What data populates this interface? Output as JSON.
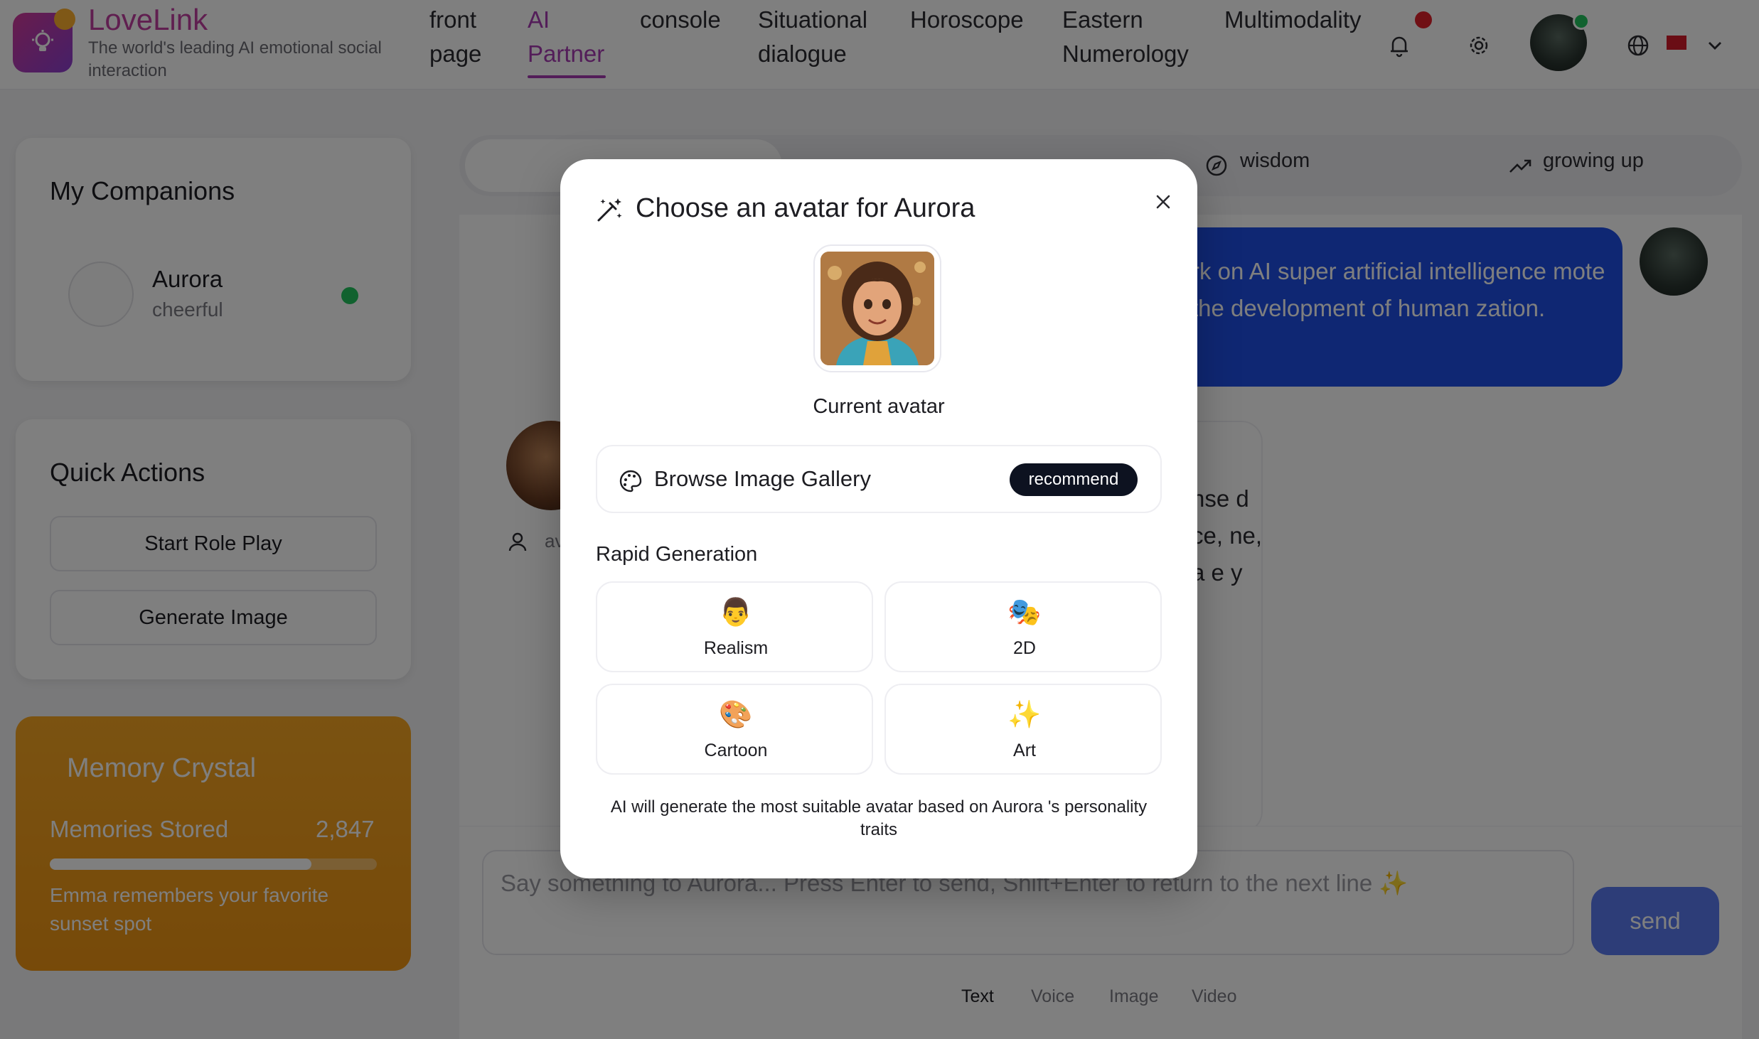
{
  "header": {
    "brand": "LoveLink",
    "tagline": "The world's leading AI emotional social interaction",
    "nav": [
      {
        "label": "front page"
      },
      {
        "label": "AI Partner"
      },
      {
        "label": "console"
      },
      {
        "label": "Situational dialogue"
      },
      {
        "label": "Horoscope"
      },
      {
        "label": "Eastern Numerology"
      },
      {
        "label": "Multimodality"
      }
    ],
    "icons": [
      "bell-icon",
      "gear-icon",
      "globe-icon",
      "chevron-down-icon"
    ]
  },
  "sidebar": {
    "companions_title": "My Companions",
    "companion": {
      "name": "Aurora",
      "mood": "cheerful"
    },
    "quick_title": "Quick Actions",
    "actions": [
      "Start Role Play",
      "Generate Image"
    ],
    "memory": {
      "title": "Memory Crystal",
      "label": "Memories Stored",
      "count": "2,847",
      "progress": 0.8,
      "note": "Emma remembers your favorite sunset spot"
    }
  },
  "main": {
    "tabs": [
      {
        "label": "wisdom"
      },
      {
        "label": "growing up"
      }
    ],
    "user_message": "rk on AI super artificial intelligence mote the development of human zation.",
    "ai_message_fragment": "nse d ce, ne, a e y",
    "ai_meta_fragment": "av",
    "input_placeholder": "Say something to Aurora... Press Enter to send, Shift+Enter to return to the next line ✨",
    "send_label": "send",
    "modes": [
      "Text",
      "Voice",
      "Image",
      "Video"
    ]
  },
  "modal": {
    "title_prefix": "Choose an avatar for",
    "companion_name": "Aurora",
    "current_label": "Current avatar",
    "gallery_label": "Browse Image Gallery",
    "badge": "recommend",
    "rapid_title": "Rapid Generation",
    "options": [
      {
        "emoji": "👨",
        "label": "Realism"
      },
      {
        "emoji": "🎭",
        "label": "2D"
      },
      {
        "emoji": "🎨",
        "label": "Cartoon"
      },
      {
        "emoji": "✨",
        "label": "Art"
      }
    ],
    "footer": "AI will generate the most suitable avatar based on Aurora 's personality traits"
  }
}
